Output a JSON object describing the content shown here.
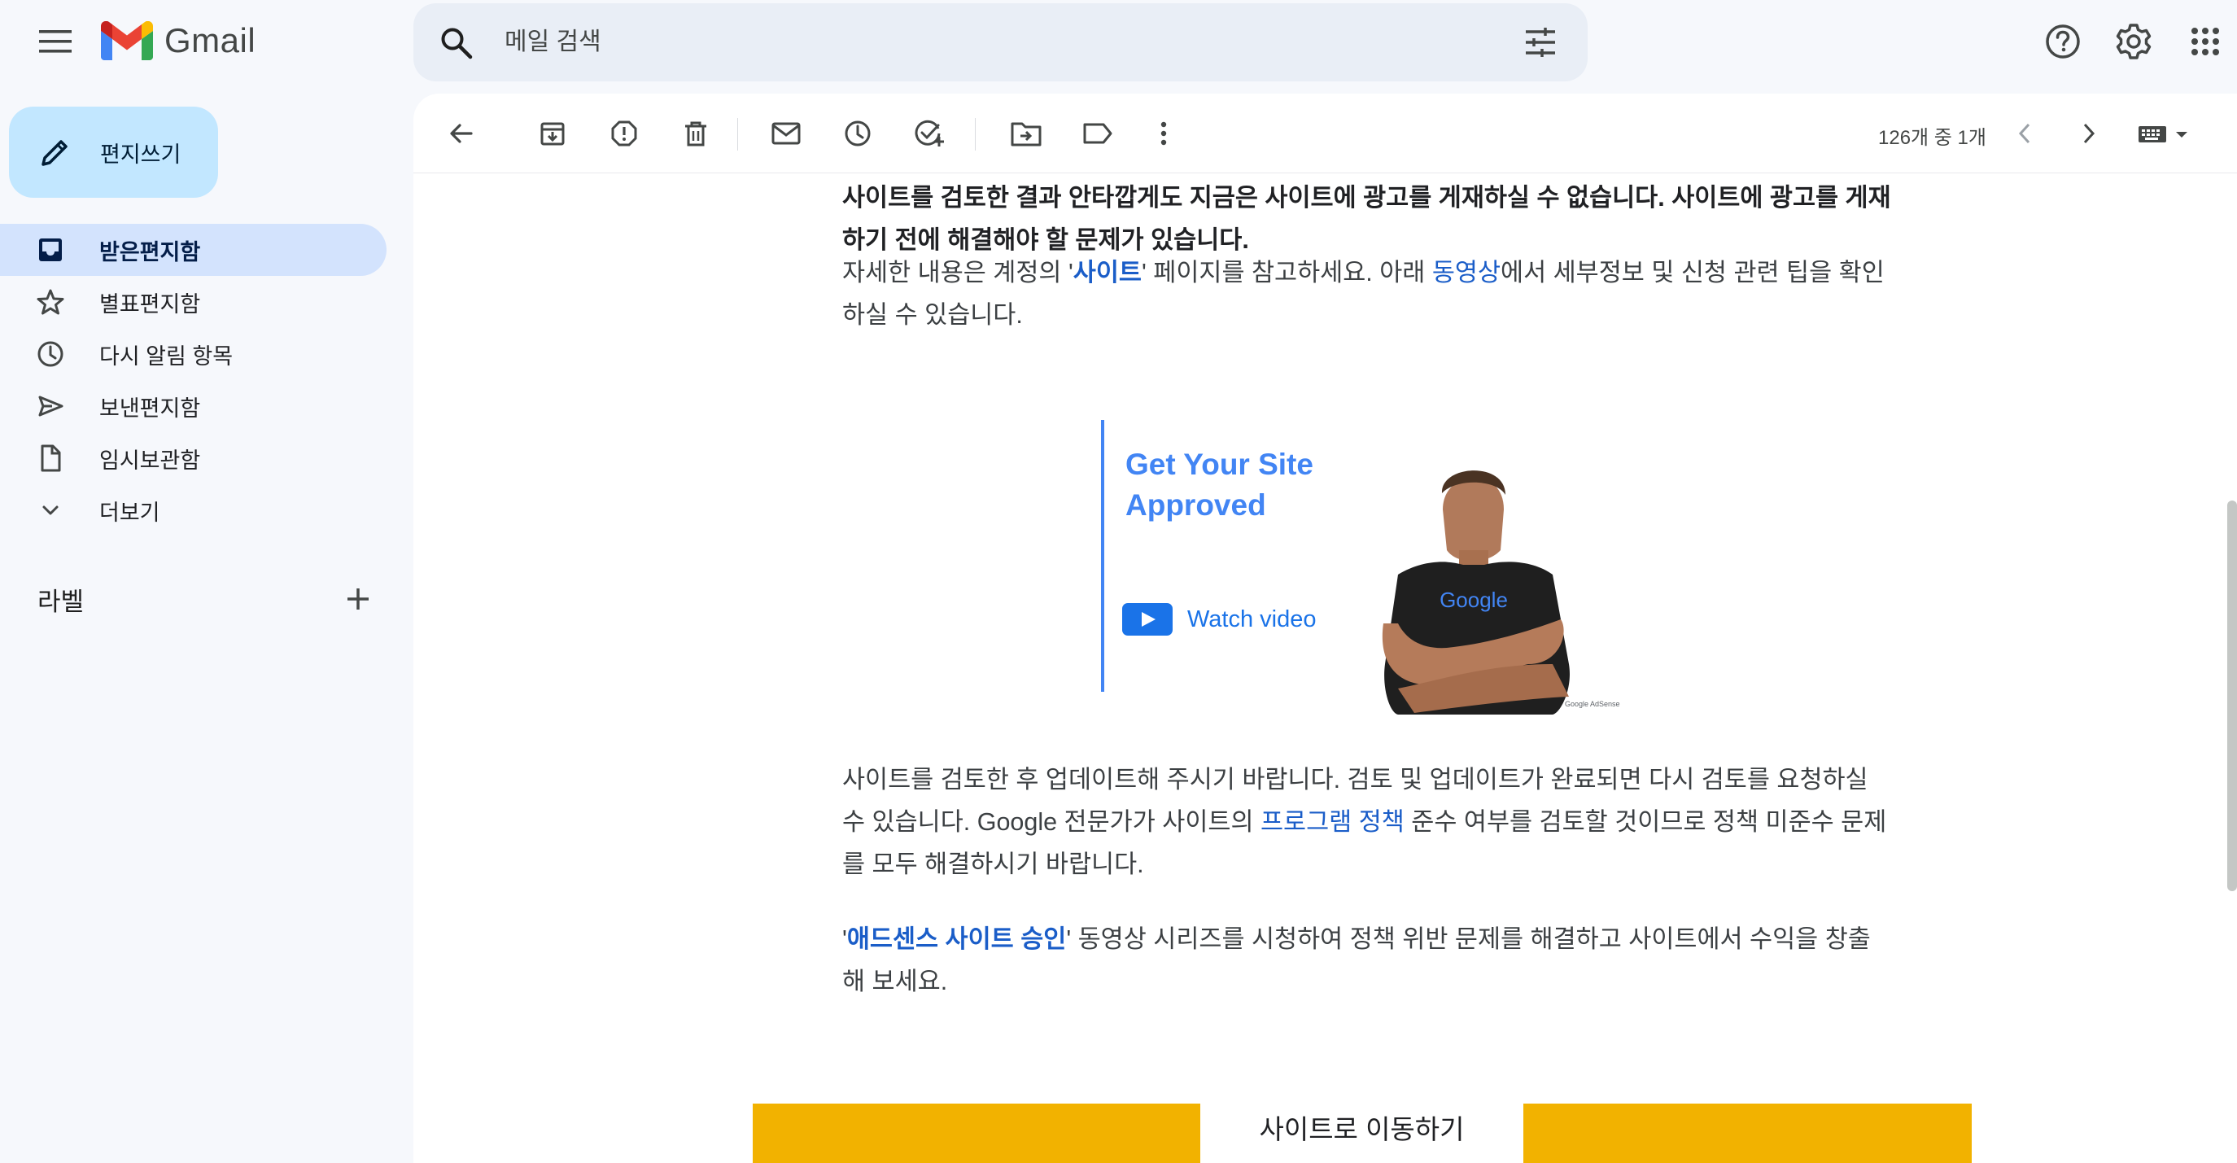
{
  "app": {
    "name": "Gmail"
  },
  "search": {
    "placeholder": "메일 검색"
  },
  "compose": {
    "label": "편지쓰기"
  },
  "sidebar": {
    "items": [
      {
        "label": "받은편지함",
        "icon": "inbox-icon",
        "active": true
      },
      {
        "label": "별표편지함",
        "icon": "star-icon",
        "active": false
      },
      {
        "label": "다시 알림 항목",
        "icon": "clock-icon",
        "active": false
      },
      {
        "label": "보낸편지함",
        "icon": "send-icon",
        "active": false
      },
      {
        "label": "임시보관함",
        "icon": "draft-icon",
        "active": false
      },
      {
        "label": "더보기",
        "icon": "chevron-down-icon",
        "active": false
      }
    ],
    "labels_heading": "라벨"
  },
  "toolbar": {
    "pager": "126개 중 1개"
  },
  "email": {
    "p1": "사이트를 검토한 결과 안타깝게도 지금은 사이트에 광고를 게재하실 수 없습니다. 사이트에 광고를 게재하기 전에 해결해야 할 문제가 있습니다.",
    "p2_a": "자세한 내용은 계정의 '",
    "p2_link1": "사이트",
    "p2_b": "' 페이지를 참고하세요. 아래 ",
    "p2_link2": "동영상",
    "p2_c": "에서 세부정보 및 신청 관련 팁을 확인하실 수 있습니다.",
    "video_title": "Get Your Site Approved",
    "video_cta": "Watch video",
    "video_shirt": "Google",
    "video_mark": "Google AdSense",
    "p3_a": "사이트를 검토한 후 업데이트해 주시기 바랍니다. 검토 및 업데이트가 완료되면 다시 검토를 요청하실 수 있습니다. Google 전문가가 사이트의 ",
    "p3_link": "프로그램 정책",
    "p3_b": " 준수 여부를 검토할 것이므로 정책 미준수 문제를 모두 해결하시기 바랍니다.",
    "p4_a": "'",
    "p4_link": "애드센스 사이트 승인",
    "p4_b": "' 동영상 시리즈를 시청하여 정책 위반 문제를 해결하고 사이트에서 수익을 창출해 보세요.",
    "cta": "사이트로 이동하기"
  },
  "colors": {
    "accent": "#c2e7ff",
    "active_nav": "#d3e3fd",
    "link": "#1a5dc8",
    "banner": "#f2b200",
    "video_blue": "#4285f4"
  }
}
